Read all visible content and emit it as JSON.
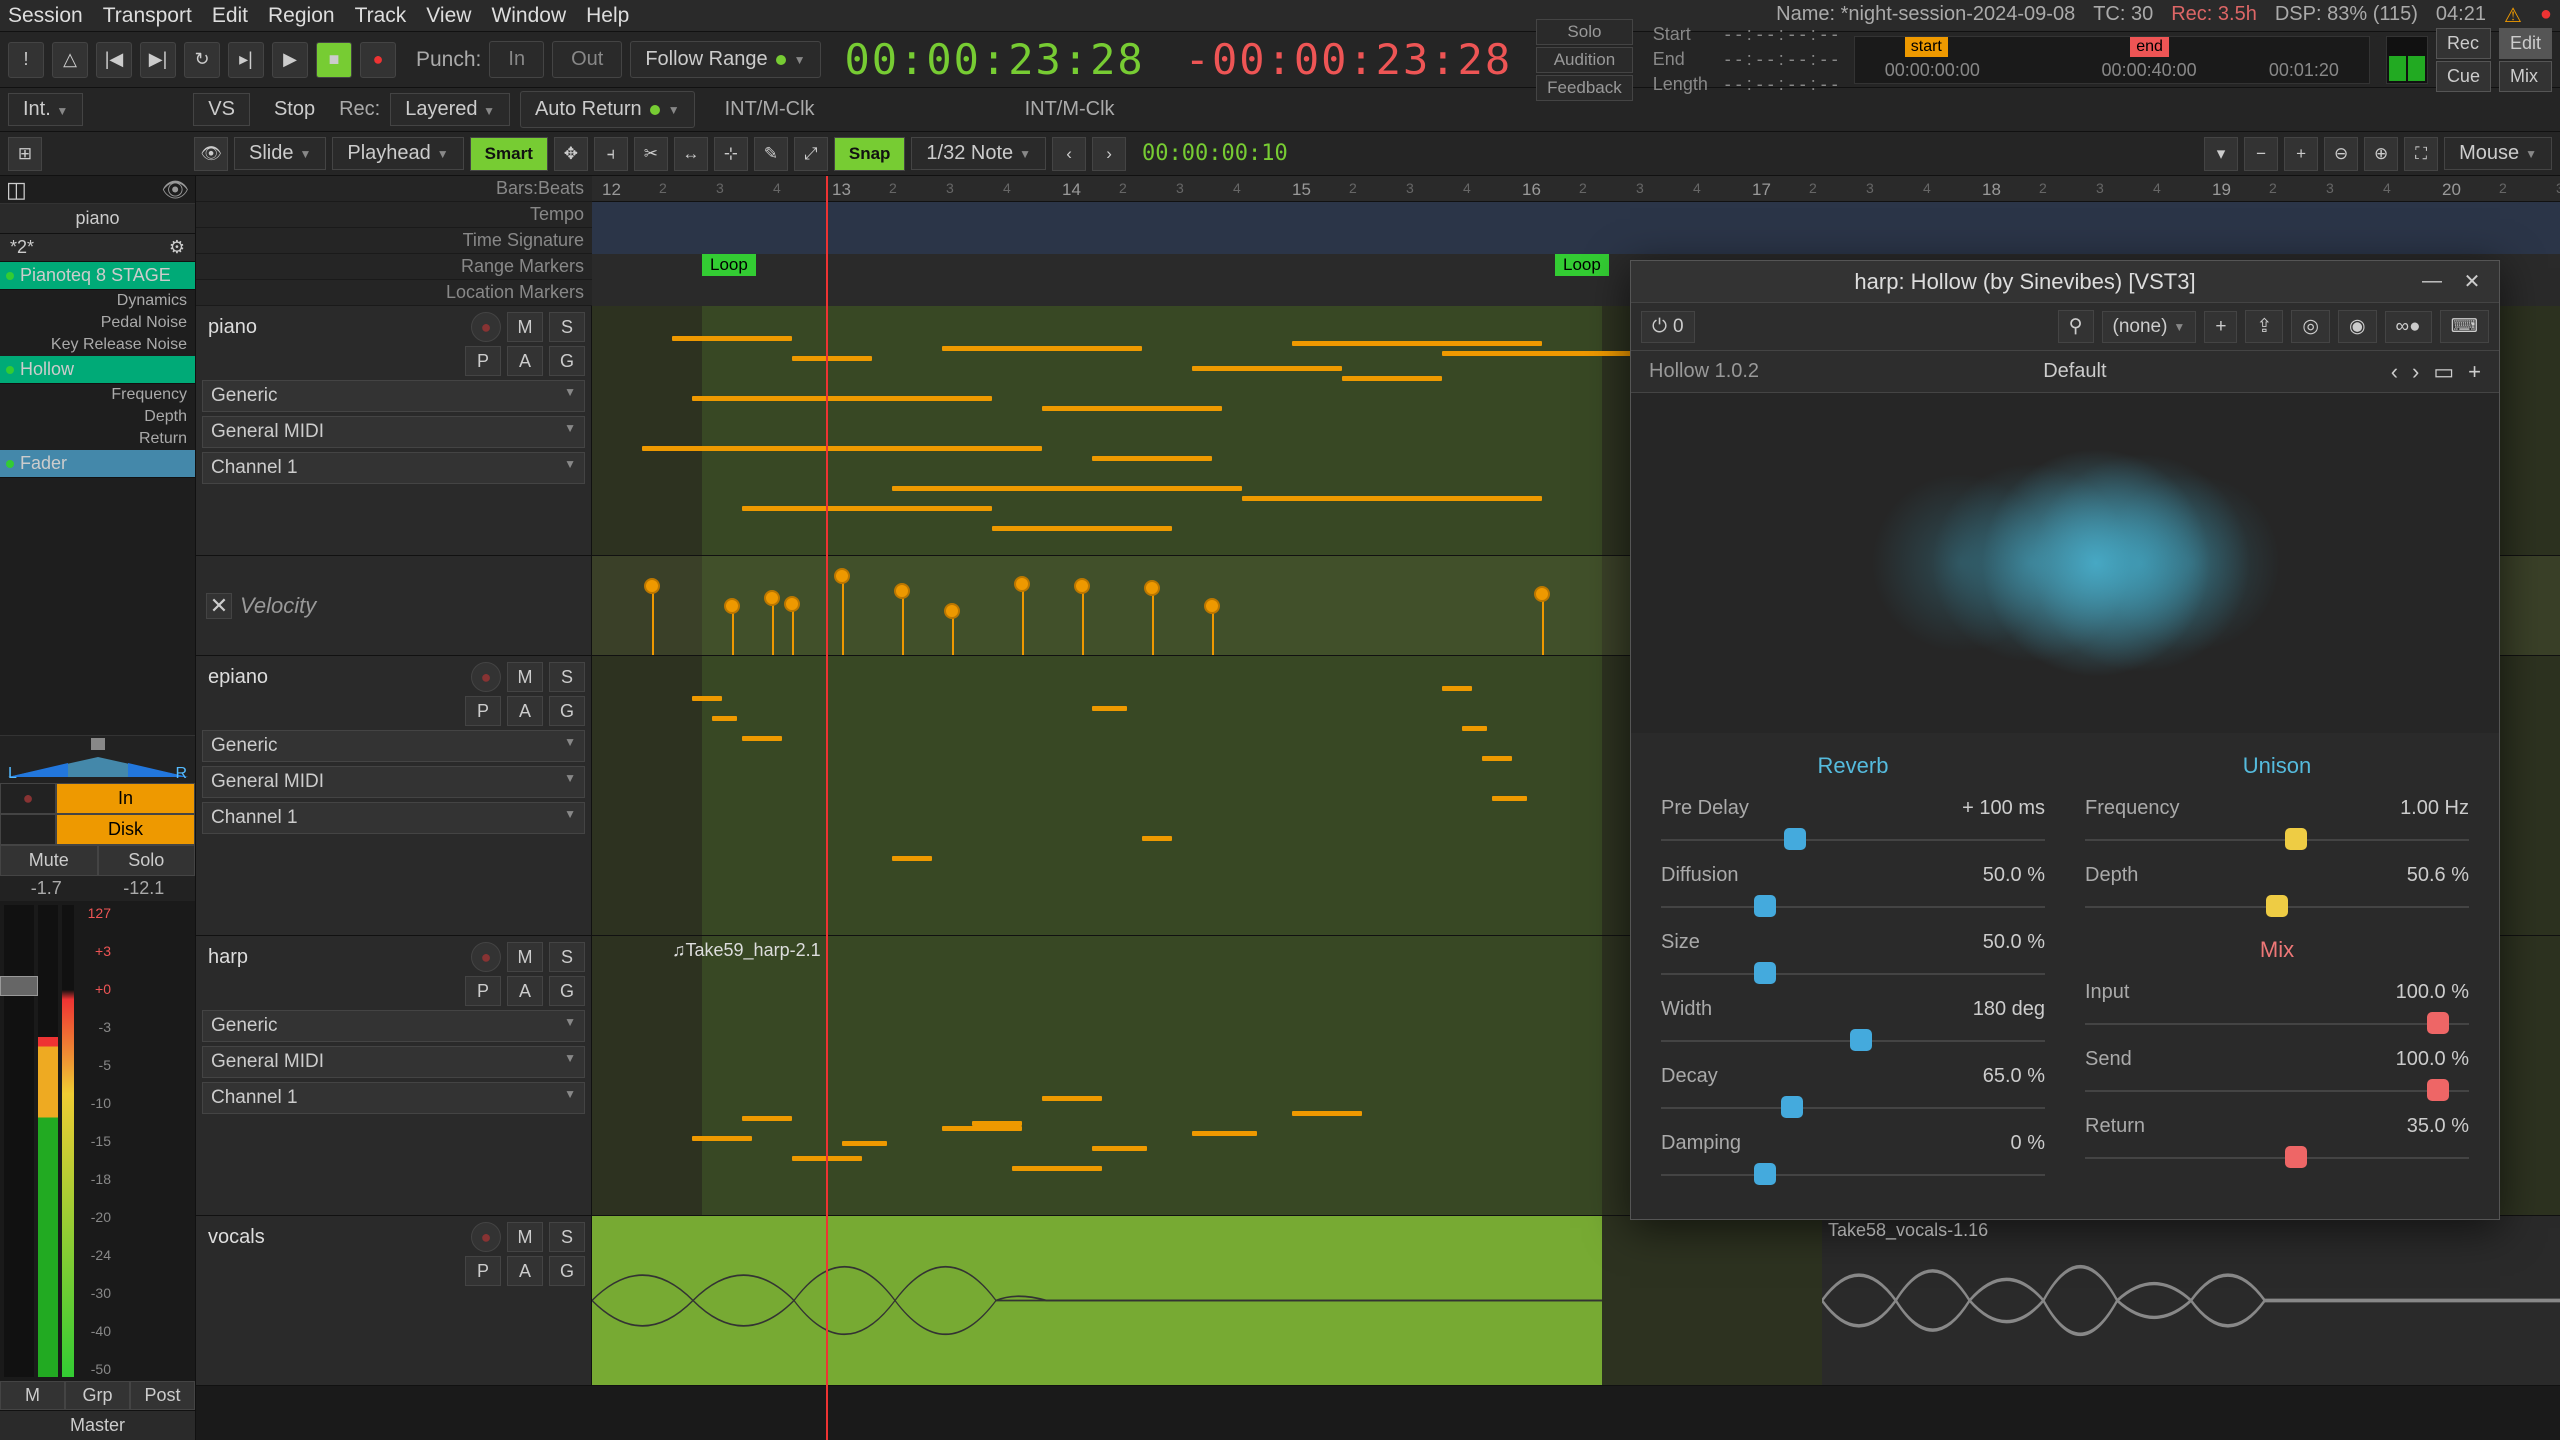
{
  "menu": {
    "items": [
      "Session",
      "Transport",
      "Edit",
      "Region",
      "Track",
      "View",
      "Window",
      "Help"
    ]
  },
  "status": {
    "name_label": "Name:",
    "name": "*night-session-2024-09-08",
    "tc_label": "TC:",
    "tc": "30",
    "rec_label": "Rec:",
    "rec": "3.5h",
    "dsp_label": "DSP:",
    "dsp": "83% (115)",
    "clock": "04:21"
  },
  "transport": {
    "punch_label": "Punch:",
    "punch_in": "In",
    "punch_out": "Out",
    "follow": "Follow Range",
    "tc_main": "00:00:23:28",
    "tc_delta": "-00:00:23:28",
    "side": [
      "Solo",
      "Audition",
      "Feedback"
    ],
    "info_labels": [
      "Start",
      "End",
      "Length"
    ],
    "info_val": "- - : - - : - - : - -",
    "tl_start": "00:00:00:00",
    "tl_mid": "00:00:40:00",
    "tl_end": "00:01:20",
    "m_start": "start",
    "m_end": "end",
    "rec": "Rec",
    "edit": "Edit",
    "cue": "Cue",
    "mix": "Mix"
  },
  "tb2": {
    "int": "Int.",
    "vs": "VS",
    "stop": "Stop",
    "rec": "Rec:",
    "layered": "Layered",
    "auto": "Auto Return",
    "clk1": "INT/M-Clk",
    "clk2": "INT/M-Clk"
  },
  "tb3": {
    "slide": "Slide",
    "playhead": "Playhead",
    "smart": "Smart",
    "snap": "Snap",
    "grid": "1/32 Note",
    "nudge": "00:00:00:10",
    "mouse": "Mouse"
  },
  "sidebar": {
    "track": "piano",
    "alt": "*2*",
    "plugins": [
      {
        "name": "Pianoteq 8 STAGE",
        "cls": "active",
        "subs": [
          "Dynamics",
          "Pedal Noise",
          "Key Release Noise"
        ]
      },
      {
        "name": "Hollow",
        "cls": "hollow",
        "subs": [
          "Frequency",
          "Depth",
          "Return"
        ]
      },
      {
        "name": "Fader",
        "cls": "fader",
        "subs": []
      }
    ],
    "rec_circle": "",
    "in": "In",
    "disk": "Disk",
    "mute": "Mute",
    "solo": "Solo",
    "val1": "-1.7",
    "val2": "-12.1",
    "scale": [
      "127",
      "+3",
      "+0",
      "-3",
      "-5",
      "-10",
      "-15",
      "-18",
      "-20",
      "-24",
      "-30",
      "-40",
      "-50"
    ],
    "m": "M",
    "grp": "Grp",
    "post": "Post",
    "master": "Master"
  },
  "rulers": {
    "labels": [
      "Bars:Beats",
      "Tempo",
      "Time Signature",
      "Range Markers",
      "Location Markers"
    ],
    "bars": [
      12,
      13,
      14,
      15,
      16,
      17,
      18,
      19,
      20
    ],
    "loop": "Loop"
  },
  "tracks": [
    {
      "name": "piano",
      "kind": "midi",
      "sels": [
        "Generic",
        "General MIDI",
        "Channel 1"
      ]
    },
    {
      "name": "epiano",
      "kind": "midi",
      "sels": [
        "Generic",
        "General MIDI",
        "Channel 1"
      ]
    },
    {
      "name": "harp",
      "kind": "midi",
      "sels": [
        "Generic",
        "General MIDI",
        "Channel 1"
      ],
      "region": "♫Take59_harp-2.1"
    },
    {
      "name": "vocals",
      "kind": "audio",
      "region": "Take58_vocals-1.16"
    }
  ],
  "th_btns": {
    "m": "M",
    "s": "S",
    "p": "P",
    "a": "A",
    "g": "G"
  },
  "velocity": {
    "label": "Velocity"
  },
  "plugin": {
    "title": "harp: Hollow (by Sinevibes) [VST3]",
    "bypass": "0",
    "preset_sel": "(none)",
    "version": "Hollow 1.0.2",
    "preset": "Default",
    "sections": {
      "reverb": "Reverb",
      "unison": "Unison",
      "mix": "Mix"
    },
    "reverb": [
      {
        "label": "Pre Delay",
        "val": "+ 100 ms",
        "pos": 35,
        "color": "blue"
      },
      {
        "label": "Diffusion",
        "val": "50.0 %",
        "pos": 27,
        "color": "blue"
      },
      {
        "label": "Size",
        "val": "50.0 %",
        "pos": 27,
        "color": "blue"
      },
      {
        "label": "Width",
        "val": "180 deg",
        "pos": 52,
        "color": "blue"
      },
      {
        "label": "Decay",
        "val": "65.0 %",
        "pos": 34,
        "color": "blue"
      },
      {
        "label": "Damping",
        "val": "0 %",
        "pos": 27,
        "color": "blue"
      }
    ],
    "unison": [
      {
        "label": "Frequency",
        "val": "1.00 Hz",
        "pos": 55,
        "color": "yellow"
      },
      {
        "label": "Depth",
        "val": "50.6 %",
        "pos": 50,
        "color": "yellow"
      }
    ],
    "mix": [
      {
        "label": "Input",
        "val": "100.0 %",
        "pos": 92,
        "color": "red"
      },
      {
        "label": "Send",
        "val": "100.0 %",
        "pos": 92,
        "color": "red"
      },
      {
        "label": "Return",
        "val": "35.0 %",
        "pos": 55,
        "color": "red"
      }
    ]
  }
}
